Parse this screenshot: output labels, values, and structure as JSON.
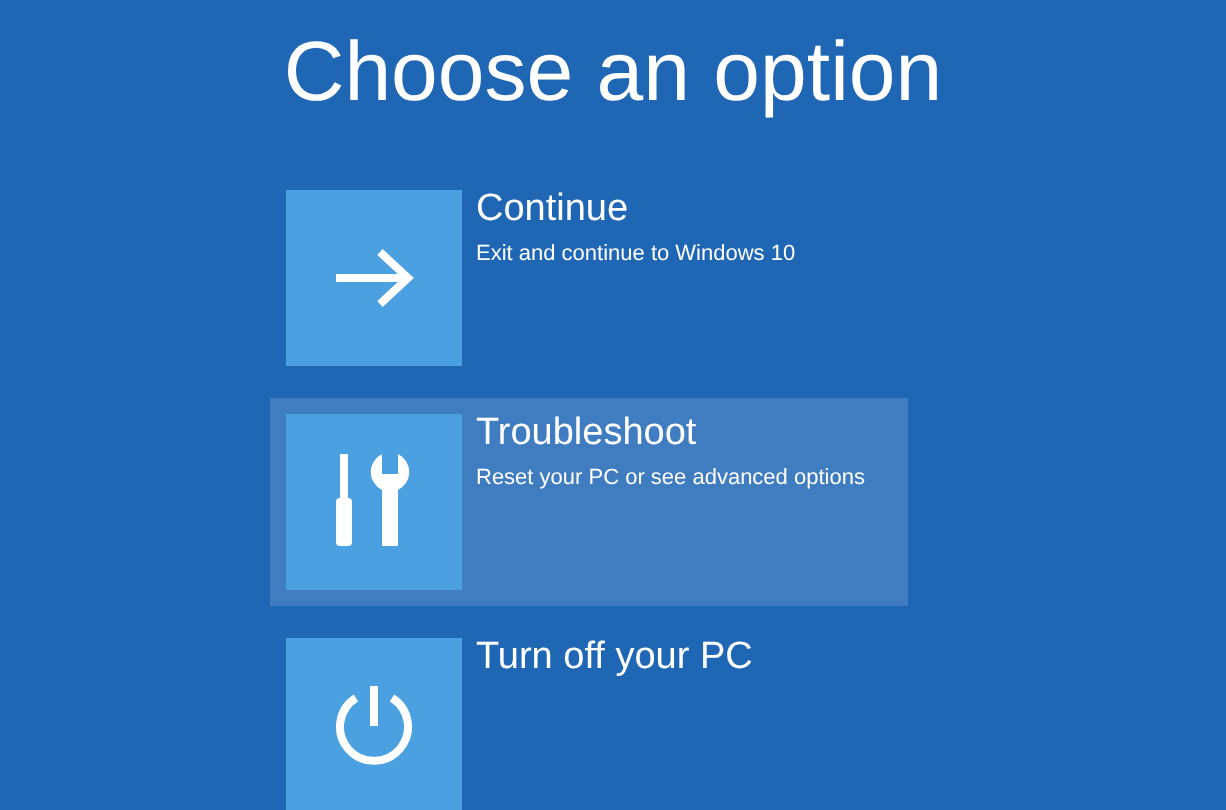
{
  "title": "Choose an option",
  "options": [
    {
      "kind": "arrow",
      "label": "Continue",
      "description": "Exit and continue to Windows 10",
      "selected": false
    },
    {
      "kind": "tools",
      "label": "Troubleshoot",
      "description": "Reset your PC or see advanced options",
      "selected": true
    },
    {
      "kind": "power",
      "label": "Turn off your PC",
      "selected": false
    }
  ]
}
